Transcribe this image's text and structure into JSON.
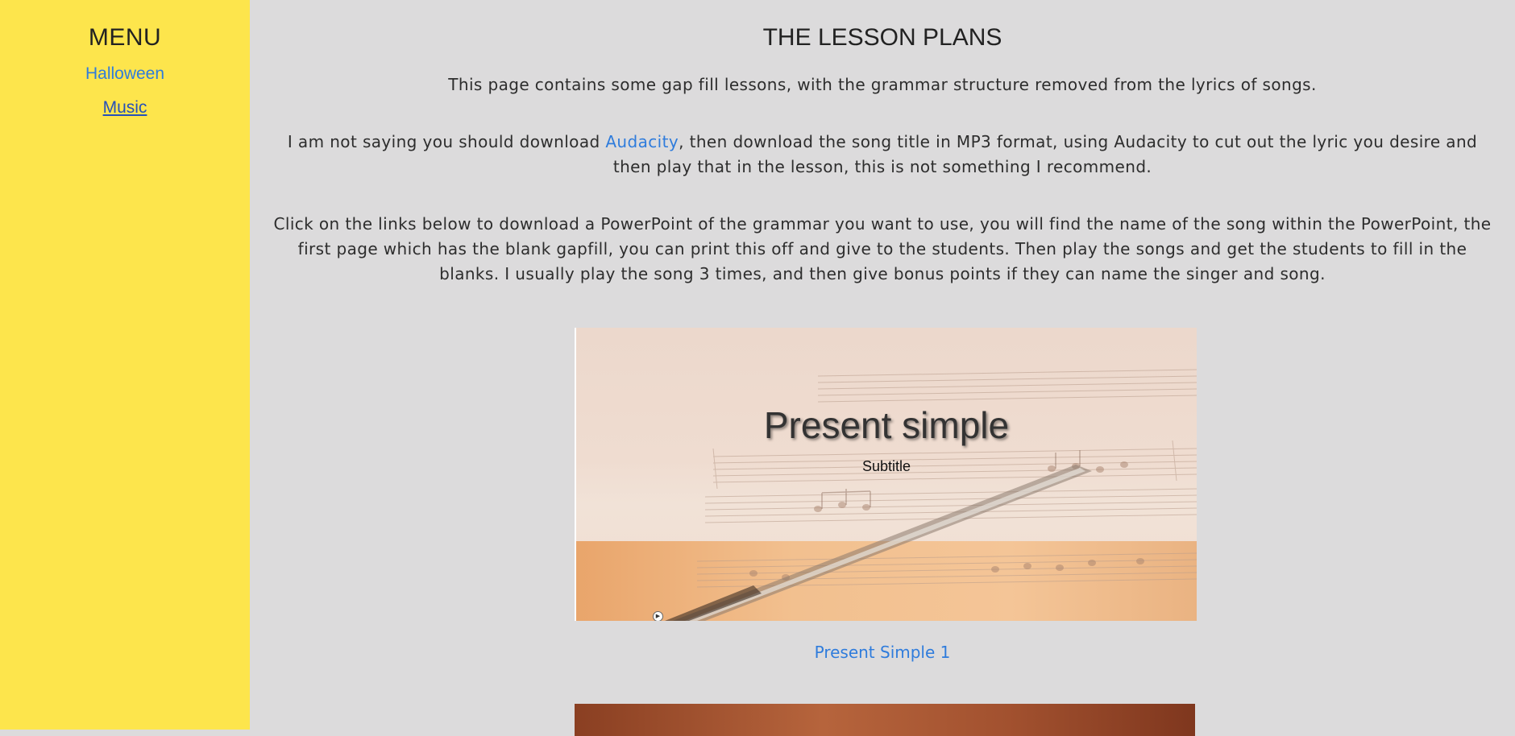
{
  "sidebar": {
    "title": "MENU",
    "items": [
      {
        "label": "Halloween"
      },
      {
        "label": "Music"
      }
    ]
  },
  "main": {
    "title": "THE LESSON PLANS",
    "paragraphs": {
      "intro": "This page contains some gap fill lessons, with the grammar structure removed from the lyrics of songs.",
      "p2_before": "I am not saying you should download ",
      "p2_link": "Audacity",
      "p2_after": ", then download the song title in MP3 format, using Audacity to cut out the lyric you desire and then play that in the lesson, this is not something I recommend.",
      "p3": "Click on the links below to download a PowerPoint of the grammar you want to use, you will find the name of the song within the PowerPoint, the first page which has the blank gapfill, you can print this off and give to the students. Then play the songs and get the students to fill in the blanks. I usually play the song 3 times, and then give bonus points if they can name the singer and song."
    },
    "lessons": [
      {
        "slide_title": "Present simple",
        "slide_subtitle": "Subtitle",
        "link_label": "Present Simple 1"
      }
    ]
  },
  "colors": {
    "sidebar_bg": "#fde54c",
    "page_bg": "#dcdbdc",
    "link": "#2f7cdc"
  }
}
